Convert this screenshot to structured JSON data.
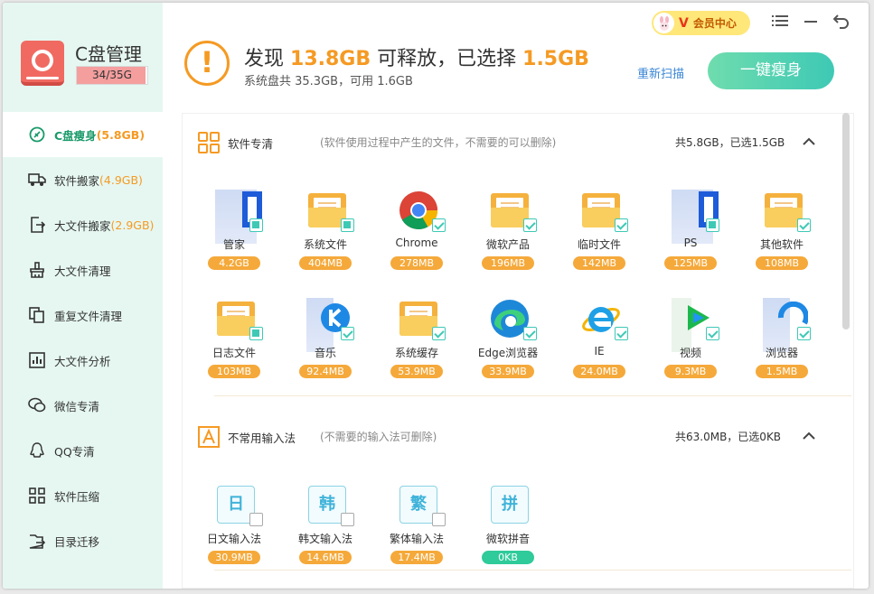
{
  "app": {
    "title": "C盘管理",
    "disk_usage": "34/35G",
    "disk_usage_fraction": 0.97
  },
  "sidebar": {
    "items": [
      {
        "label": "C盘瘦身",
        "size": "(5.8GB)",
        "icon": "broom-circle-icon",
        "active": true
      },
      {
        "label": "软件搬家",
        "size": "(4.9GB)",
        "icon": "truck-icon"
      },
      {
        "label": "大文件搬家",
        "size": "(2.9GB)",
        "icon": "file-export-icon"
      },
      {
        "label": "大文件清理",
        "size": "",
        "icon": "brush-icon"
      },
      {
        "label": "重复文件清理",
        "size": "",
        "icon": "duplicate-icon"
      },
      {
        "label": "大文件分析",
        "size": "",
        "icon": "chart-icon"
      },
      {
        "label": "微信专清",
        "size": "",
        "icon": "wechat-icon"
      },
      {
        "label": "QQ专清",
        "size": "",
        "icon": "qq-icon"
      },
      {
        "label": "软件压缩",
        "size": "",
        "icon": "grid-icon"
      },
      {
        "label": "目录迁移",
        "size": "",
        "icon": "folder-export-icon"
      }
    ]
  },
  "header": {
    "headline_pre": "发现",
    "found_size": "13.8GB",
    "headline_mid": "可释放，已选择",
    "selected_size": "1.5GB",
    "subline": "系统盘共 35.3GB，可用 1.6GB",
    "rescan_label": "重新扫描",
    "oneclick_label": "一键瘦身",
    "vip_label": "会员中心",
    "vip_badge": "V"
  },
  "sections": [
    {
      "title": "软件专清",
      "desc": "(软件使用过程中产生的文件，不需要的可以删除)",
      "summary": "共5.8GB，已选1.5GB",
      "icon": "grid-apps-icon",
      "items": [
        {
          "label": "管家",
          "size": "4.2GB",
          "icon": "app-icon-blurred",
          "check": "partial"
        },
        {
          "label": "系统文件",
          "size": "404MB",
          "icon": "folder-icon",
          "check": "partial"
        },
        {
          "label": "Chrome",
          "size": "278MB",
          "icon": "chrome-icon",
          "check": "on"
        },
        {
          "label": "微软产品",
          "size": "196MB",
          "icon": "folder-icon",
          "check": "on"
        },
        {
          "label": "临时文件",
          "size": "142MB",
          "icon": "folder-icon",
          "check": "on"
        },
        {
          "label": "PS",
          "size": "125MB",
          "icon": "app-icon-blurred",
          "check": "partial"
        },
        {
          "label": "其他软件",
          "size": "108MB",
          "icon": "folder-icon",
          "check": "on"
        },
        {
          "label": "日志文件",
          "size": "103MB",
          "icon": "folder-icon",
          "check": "partial"
        },
        {
          "label": "音乐",
          "size": "92.4MB",
          "icon": "music-app-icon",
          "check": "on"
        },
        {
          "label": "系统缓存",
          "size": "53.9MB",
          "icon": "folder-icon",
          "check": "on"
        },
        {
          "label": "Edge浏览器",
          "size": "33.9MB",
          "icon": "edge-icon",
          "check": "on"
        },
        {
          "label": "IE",
          "size": "24.0MB",
          "icon": "ie-icon",
          "check": "on"
        },
        {
          "label": "视频",
          "size": "9.3MB",
          "icon": "video-app-icon",
          "check": "on"
        },
        {
          "label": "浏览器",
          "size": "1.5MB",
          "icon": "browser-app-icon",
          "check": "on"
        }
      ]
    },
    {
      "title": "不常用输入法",
      "desc": "(不需要的输入法可删除)",
      "summary": "共63.0MB，已选0KB",
      "icon": "letter-a-icon",
      "items": [
        {
          "label": "日文输入法",
          "size": "30.9MB",
          "glyph": "日",
          "check": "off"
        },
        {
          "label": "韩文输入法",
          "size": "14.6MB",
          "glyph": "韩",
          "check": "off"
        },
        {
          "label": "繁体输入法",
          "size": "17.4MB",
          "glyph": "繁",
          "check": "off"
        },
        {
          "label": "微软拼音",
          "size": "0KB",
          "glyph": "拼",
          "check": "none"
        }
      ]
    }
  ],
  "colors": {
    "accent_orange": "#f59a23",
    "accent_teal": "#3ec9b5",
    "sidebar_bg": "#e6f7f1",
    "link_blue": "#3a86d6"
  }
}
